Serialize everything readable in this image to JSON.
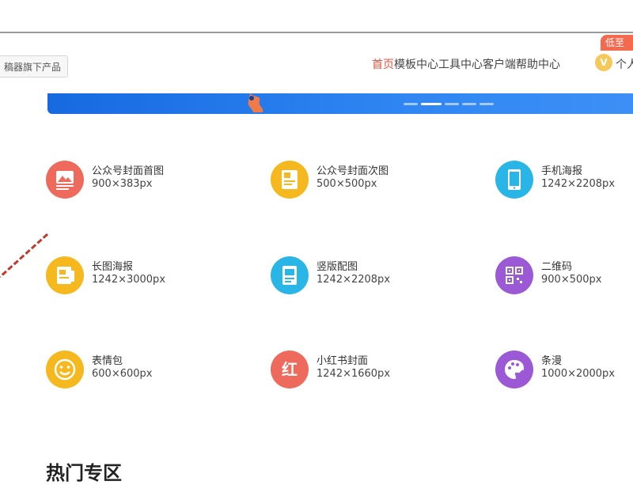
{
  "header": {
    "product_button": "稿器旗下产品",
    "nav": [
      "首页",
      "模板中心",
      "工具中心",
      "客户端",
      "帮助中心"
    ],
    "vip_badge": "低至",
    "vip_icon": "V",
    "personal": "个人"
  },
  "banner": {
    "dots_count": 5,
    "active_dot": 1
  },
  "templates": [
    {
      "name": "公众号封面首图",
      "size": "900×383px",
      "icon": "image-icon",
      "color": "#ee6a5c"
    },
    {
      "name": "公众号封面次图",
      "size": "500×500px",
      "icon": "doc-image-icon",
      "color": "#f5b91f"
    },
    {
      "name": "手机海报",
      "size": "1242×2208px",
      "icon": "phone-icon",
      "color": "#29b6e6"
    },
    {
      "name": "长图海报",
      "size": "1242×3000px",
      "icon": "long-poster-icon",
      "color": "#f5b91f"
    },
    {
      "name": "竖版配图",
      "size": "1242×2208px",
      "icon": "vertical-image-icon",
      "color": "#29b6e6"
    },
    {
      "name": "二维码",
      "size": "900×500px",
      "icon": "qrcode-icon",
      "color": "#9b59d6"
    },
    {
      "name": "表情包",
      "size": "600×600px",
      "icon": "smiley-icon",
      "color": "#f5b91f"
    },
    {
      "name": "小红书封面",
      "size": "1242×1660px",
      "icon": "red-text-icon",
      "color": "#ee6a5c"
    },
    {
      "name": "条漫",
      "size": "1000×2000px",
      "icon": "palette-icon",
      "color": "#9b59d6"
    }
  ],
  "section": {
    "title": "热门专区"
  }
}
